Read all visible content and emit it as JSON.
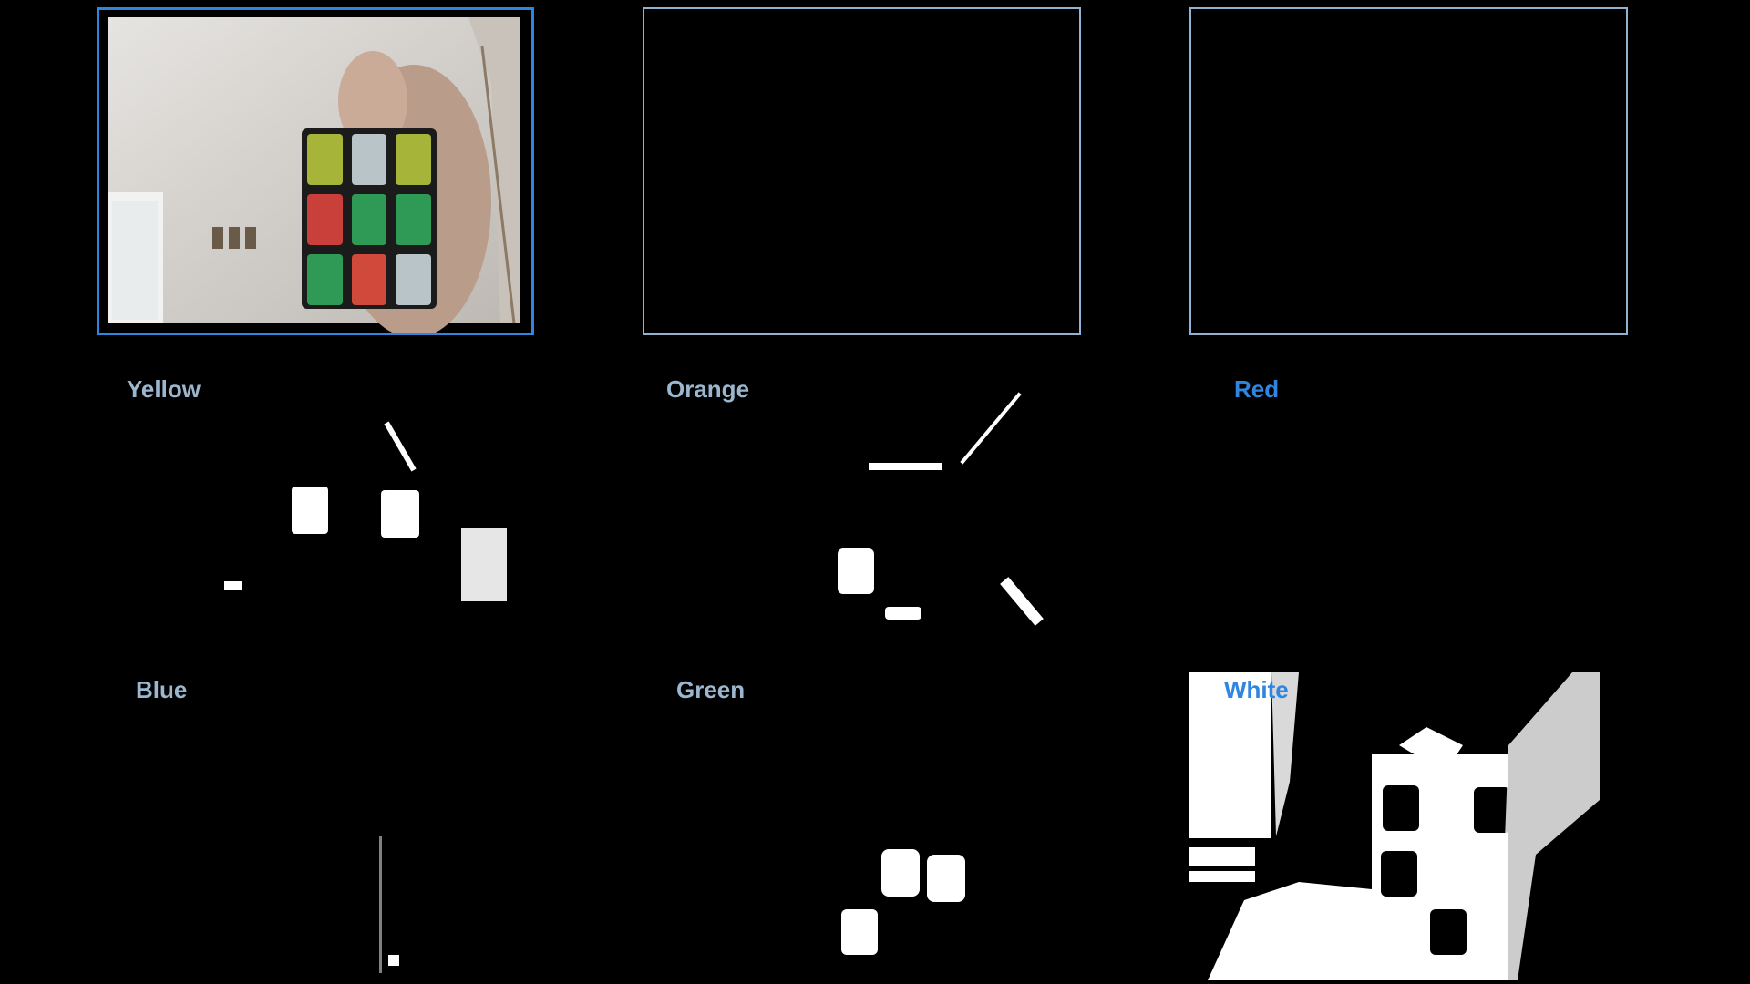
{
  "panels": {
    "camera": {
      "selected": true
    },
    "preview_2": {
      "selected": false
    },
    "preview_3": {
      "selected": false
    }
  },
  "masks": [
    {
      "id": "yellow",
      "label": "Yellow",
      "label_color": "#9ab7cf",
      "active": false
    },
    {
      "id": "orange",
      "label": "Orange",
      "label_color": "#9ab7cf",
      "active": false
    },
    {
      "id": "red",
      "label": "Red",
      "label_color": "#2f86e0",
      "active": true
    },
    {
      "id": "blue",
      "label": "Blue",
      "label_color": "#9ab7cf",
      "active": false
    },
    {
      "id": "green",
      "label": "Green",
      "label_color": "#9ab7cf",
      "active": false
    },
    {
      "id": "white",
      "label": "White",
      "label_color": "#2f86e0",
      "active": true
    }
  ],
  "cube_stickers": [
    "yellow-green",
    "gray",
    "yellow-green",
    "red",
    "green",
    "green",
    "green",
    "red",
    "gray"
  ],
  "colors": {
    "background": "#000000",
    "frame_border": "#8fb3d1",
    "selected_border": "#2f86e0",
    "mask_foreground": "#ffffff"
  }
}
